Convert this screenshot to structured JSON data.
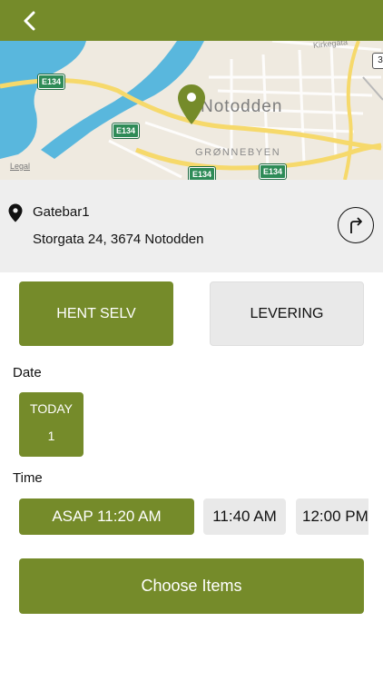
{
  "header": {
    "back_icon": "chevron-left-icon"
  },
  "map": {
    "city_label": "Notodden",
    "district_label": "GRØNNEBYEN",
    "street_label": "Kirkegata",
    "route_number": "3",
    "legal_link": "Legal",
    "road_badges": [
      "E134",
      "E134",
      "E134",
      "E134"
    ],
    "pin_icon": "map-pin-icon"
  },
  "location": {
    "name": "Gatebar1",
    "address": "Storgata 24, 3674 Notodden",
    "location_icon": "location-pin-icon",
    "directions_icon": "turn-right-arrow-icon"
  },
  "order_mode": {
    "pickup_label": "HENT SELV",
    "delivery_label": "LEVERING",
    "selected": "pickup"
  },
  "date": {
    "label": "Date",
    "options": [
      {
        "day": "TODAY",
        "number": "1"
      }
    ]
  },
  "time": {
    "label": "Time",
    "options": [
      "ASAP 11:20 AM",
      "11:40 AM",
      "12:00 PM"
    ]
  },
  "cta": {
    "label": "Choose Items"
  },
  "colors": {
    "primary": "#758b2a",
    "secondary": "#e9e9e9",
    "panel": "#eeeeee",
    "water": "#59b7dd"
  }
}
